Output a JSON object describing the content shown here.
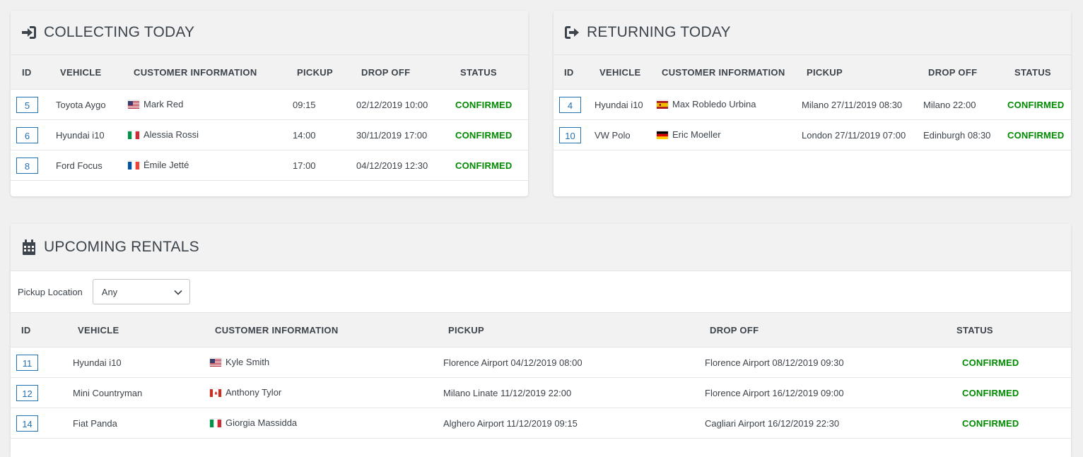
{
  "collecting": {
    "title": "COLLECTING TODAY",
    "headers": [
      "ID",
      "VEHICLE",
      "CUSTOMER INFORMATION",
      "PICKUP",
      "DROP OFF",
      "STATUS"
    ],
    "rows": [
      {
        "id": "5",
        "vehicle": "Toyota Aygo",
        "flag": "us",
        "customer": "Mark Red",
        "pickup": "09:15",
        "dropoff": "02/12/2019 10:00",
        "status": "CONFIRMED"
      },
      {
        "id": "6",
        "vehicle": "Hyundai i10",
        "flag": "it",
        "customer": "Alessia Rossi",
        "pickup": "14:00",
        "dropoff": "30/11/2019 17:00",
        "status": "CONFIRMED"
      },
      {
        "id": "8",
        "vehicle": "Ford Focus",
        "flag": "fr",
        "customer": "Émile Jetté",
        "pickup": "17:00",
        "dropoff": "04/12/2019 12:30",
        "status": "CONFIRMED"
      }
    ]
  },
  "returning": {
    "title": "RETURNING TODAY",
    "headers": [
      "ID",
      "VEHICLE",
      "CUSTOMER INFORMATION",
      "PICKUP",
      "DROP OFF",
      "STATUS"
    ],
    "rows": [
      {
        "id": "4",
        "vehicle": "Hyundai i10",
        "flag": "es",
        "customer": "Max Robledo Urbina",
        "pickup": "Milano 27/11/2019 08:30",
        "dropoff": "Milano 22:00",
        "status": "CONFIRMED"
      },
      {
        "id": "10",
        "vehicle": "VW Polo",
        "flag": "de",
        "customer": "Eric Moeller",
        "pickup": "London 27/11/2019 07:00",
        "dropoff": "Edinburgh 08:30",
        "status": "CONFIRMED"
      }
    ]
  },
  "upcoming": {
    "title": "UPCOMING RENTALS",
    "filter_label": "Pickup Location",
    "filter_value": "Any",
    "headers": [
      "ID",
      "VEHICLE",
      "CUSTOMER INFORMATION",
      "PICKUP",
      "DROP OFF",
      "STATUS"
    ],
    "rows": [
      {
        "id": "11",
        "vehicle": "Hyundai i10",
        "flag": "us",
        "customer": "Kyle Smith",
        "pickup": "Florence Airport 04/12/2019 08:00",
        "dropoff": "Florence Airport 08/12/2019 09:30",
        "status": "CONFIRMED"
      },
      {
        "id": "12",
        "vehicle": "Mini Countryman",
        "flag": "ca",
        "customer": "Anthony Tylor",
        "pickup": "Milano Linate 11/12/2019 22:00",
        "dropoff": "Florence Airport 16/12/2019 09:00",
        "status": "CONFIRMED"
      },
      {
        "id": "14",
        "vehicle": "Fiat Panda",
        "flag": "it",
        "customer": "Giorgia Massidda",
        "pickup": "Alghero Airport 11/12/2019 09:15",
        "dropoff": "Cagliari Airport 16/12/2019 22:30",
        "status": "CONFIRMED"
      }
    ]
  },
  "colors": {
    "link": "#2271b1",
    "status_confirmed": "#008a00",
    "header_bg": "#f2f2f2",
    "page_bg": "#f0f0f1"
  }
}
